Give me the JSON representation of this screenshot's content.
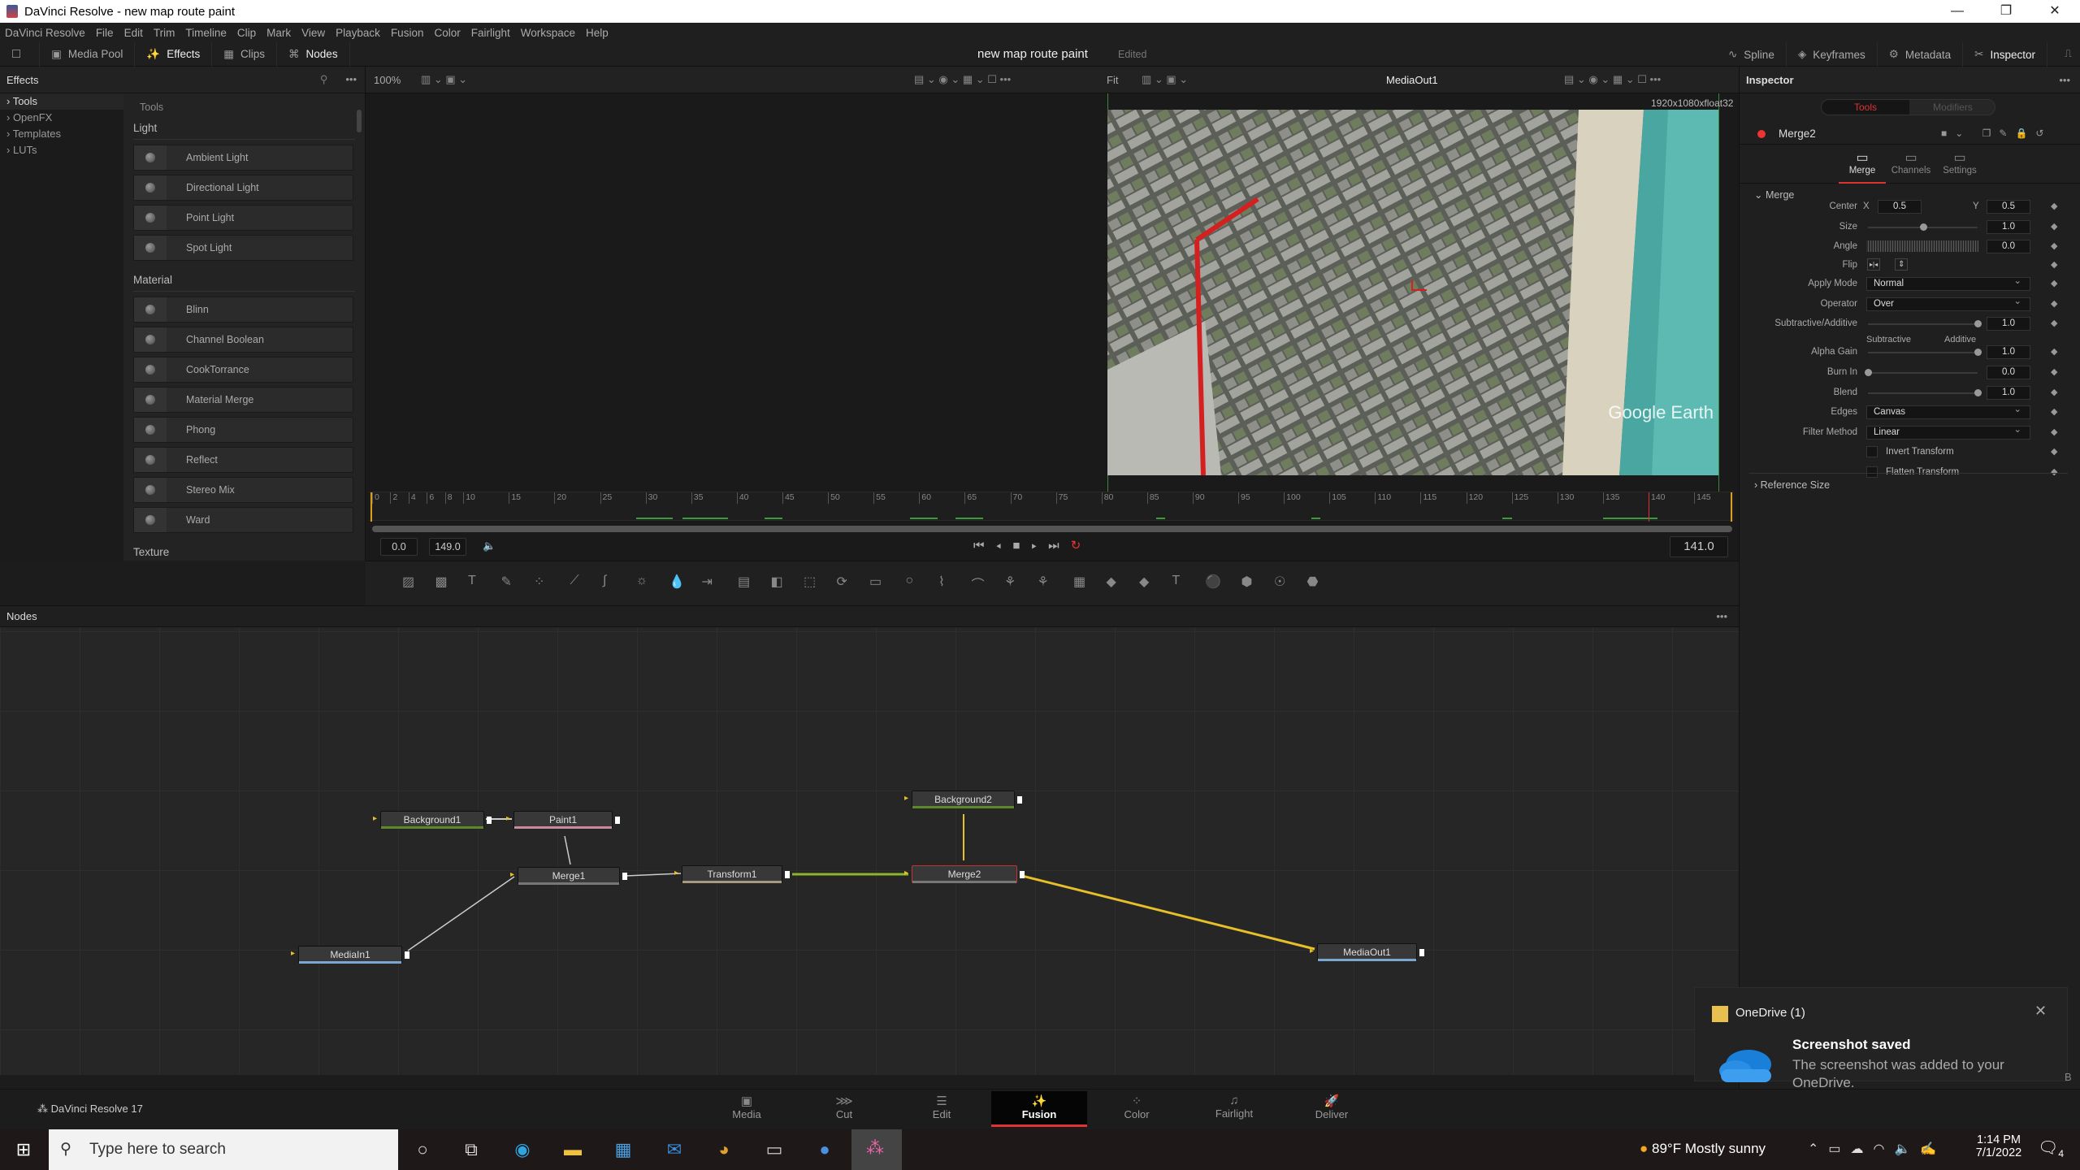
{
  "window": {
    "title": "DaVinci Resolve - new map route paint",
    "minimize": "—",
    "maximize": "❐",
    "close": "✕"
  },
  "menu": [
    "DaVinci Resolve",
    "File",
    "Edit",
    "Trim",
    "Timeline",
    "Clip",
    "Mark",
    "View",
    "Playback",
    "Fusion",
    "Color",
    "Fairlight",
    "Workspace",
    "Help"
  ],
  "toolbar": {
    "left": [
      {
        "icon": "media-pool-icon",
        "glyph": "▣",
        "label": "Media Pool"
      },
      {
        "icon": "effects-icon",
        "glyph": "✨",
        "label": "Effects",
        "active": true
      },
      {
        "icon": "clips-icon",
        "glyph": "▦",
        "label": "Clips"
      },
      {
        "icon": "nodes-icon",
        "glyph": "⌘",
        "label": "Nodes",
        "active": true
      }
    ],
    "project": "new map route paint",
    "status": "Edited",
    "right": [
      {
        "icon": "spline-icon",
        "glyph": "∿",
        "label": "Spline"
      },
      {
        "icon": "keyframes-icon",
        "glyph": "◈",
        "label": "Keyframes"
      },
      {
        "icon": "metadata-icon",
        "glyph": "⚙",
        "label": "Metadata"
      },
      {
        "icon": "inspector-icon",
        "glyph": "✂",
        "label": "Inspector",
        "active": true
      }
    ]
  },
  "effects": {
    "title": "Effects",
    "tree": [
      "Tools",
      "OpenFX",
      "Templates",
      "LUTs"
    ],
    "breadcrumb": "Tools",
    "categories": [
      {
        "name": "Light",
        "items": [
          "Ambient Light",
          "Directional Light",
          "Point Light",
          "Spot Light"
        ]
      },
      {
        "name": "Material",
        "items": [
          "Blinn",
          "Channel Boolean",
          "CookTorrance",
          "Material Merge",
          "Phong",
          "Reflect",
          "Stereo Mix",
          "Ward"
        ]
      },
      {
        "name": "Texture",
        "items": []
      }
    ]
  },
  "viewer": {
    "zoom": "100%",
    "fit": "Fit",
    "name": "MediaOut1",
    "resolution": "1920x1080xfloat32",
    "watermark": "Google Earth",
    "route_color": "#d42020",
    "ruler": [
      0,
      2,
      4,
      6,
      8,
      10,
      15,
      20,
      25,
      30,
      35,
      40,
      45,
      50,
      55,
      60,
      65,
      70,
      75,
      80,
      85,
      90,
      95,
      100,
      105,
      110,
      115,
      120,
      125,
      130,
      135,
      140,
      145
    ],
    "start": "0.0",
    "end": "149.0",
    "current": "141.0",
    "playhead_frame": 140,
    "range_end": 149
  },
  "nodes": {
    "title": "Nodes",
    "items": [
      {
        "name": "Background1",
        "color": "#5c8a2a"
      },
      {
        "name": "Paint1",
        "color": "#c98aa0"
      },
      {
        "name": "Merge1",
        "color": "#777"
      },
      {
        "name": "Transform1",
        "color": "#a89a80"
      },
      {
        "name": "Merge2",
        "color": "#777",
        "selected": true
      },
      {
        "name": "Background2",
        "color": "#5c8a2a"
      },
      {
        "name": "MediaIn1",
        "color": "#7aa6d0"
      },
      {
        "name": "MediaOut1",
        "color": "#7aa6d0"
      }
    ]
  },
  "inspector": {
    "title": "Inspector",
    "tabs": [
      "Tools",
      "Modifiers"
    ],
    "node": "Merge2",
    "subtabs": [
      "Merge",
      "Channels",
      "Settings"
    ],
    "section": "Merge",
    "center_label": "Center",
    "x_label": "X",
    "y_label": "Y",
    "center_x": "0.5",
    "center_y": "0.5",
    "size": {
      "label": "Size",
      "value": "1.0",
      "fraction": 0.5
    },
    "angle": {
      "label": "Angle",
      "value": "0.0"
    },
    "flip": "Flip",
    "apply_mode": {
      "label": "Apply Mode",
      "value": "Normal"
    },
    "operator": {
      "label": "Operator",
      "value": "Over"
    },
    "subadd": {
      "label": "Subtractive/Additive",
      "value": "1.0",
      "fraction": 1,
      "left": "Subtractive",
      "right": "Additive"
    },
    "alpha_gain": {
      "label": "Alpha Gain",
      "value": "1.0",
      "fraction": 1
    },
    "burn_in": {
      "label": "Burn In",
      "value": "0.0",
      "fraction": 0
    },
    "blend": {
      "label": "Blend",
      "value": "1.0",
      "fraction": 1
    },
    "edges": {
      "label": "Edges",
      "value": "Canvas"
    },
    "filter": {
      "label": "Filter Method",
      "value": "Linear"
    },
    "invert": "Invert Transform",
    "flatten": "Flatten Transform",
    "reference": "Reference Size"
  },
  "pages": {
    "app": "DaVinci Resolve 17",
    "items": [
      {
        "label": "Media",
        "glyph": "▣"
      },
      {
        "label": "Cut",
        "glyph": "⋙"
      },
      {
        "label": "Edit",
        "glyph": "☰"
      },
      {
        "label": "Fusion",
        "glyph": "✨",
        "active": true
      },
      {
        "label": "Color",
        "glyph": "⁘"
      },
      {
        "label": "Fairlight",
        "glyph": "♫"
      },
      {
        "label": "Deliver",
        "glyph": "🚀"
      }
    ]
  },
  "toast": {
    "app": "OneDrive (1)",
    "title": "Screenshot saved",
    "body": "The screenshot was added to your OneDrive.",
    "side_letter": "B"
  },
  "taskbar": {
    "search_placeholder": "Type here to search",
    "weather": "89°F  Mostly sunny",
    "time": "1:14 PM",
    "date": "7/1/2022",
    "notifications": "4"
  }
}
